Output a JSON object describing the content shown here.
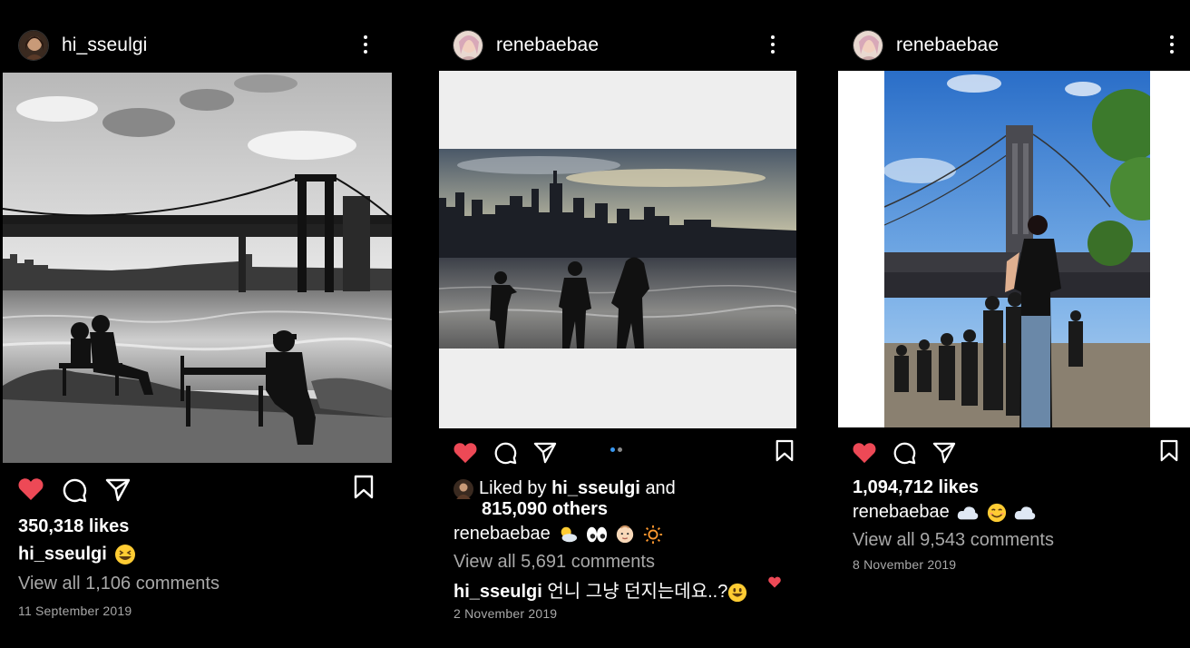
{
  "posts": [
    {
      "username": "hi_sseulgi",
      "likes": "350,318 likes",
      "caption_user": "hi_sseulgi",
      "view_comments": "View all 1,106 comments",
      "date": "11 September 2019"
    },
    {
      "username": "renebaebae",
      "liked_by_prefix": "Liked by",
      "liked_by_user": "hi_sseulgi",
      "liked_by_and": "and",
      "liked_by_others": "815,090 others",
      "caption_user": "renebaebae",
      "view_comments": "View all 5,691 comments",
      "comment_user": "hi_sseulgi",
      "comment_text": "언니 그냥 던지는데요..?",
      "date": "2 November 2019",
      "carousel_index": 1,
      "carousel_count": 2
    },
    {
      "username": "renebaebae",
      "likes": "1,094,712 likes",
      "caption_user": "renebaebae",
      "view_comments": "View all 9,543 comments",
      "date": "8 November 2019"
    }
  ],
  "colors": {
    "background": "#000000",
    "like_red": "#ed4956",
    "muted_text": "#a8a8a8",
    "carousel_active": "#3897f0"
  },
  "icons": [
    "more-options-icon",
    "heart-filled-icon",
    "comment-icon",
    "share-icon",
    "bookmark-icon"
  ]
}
